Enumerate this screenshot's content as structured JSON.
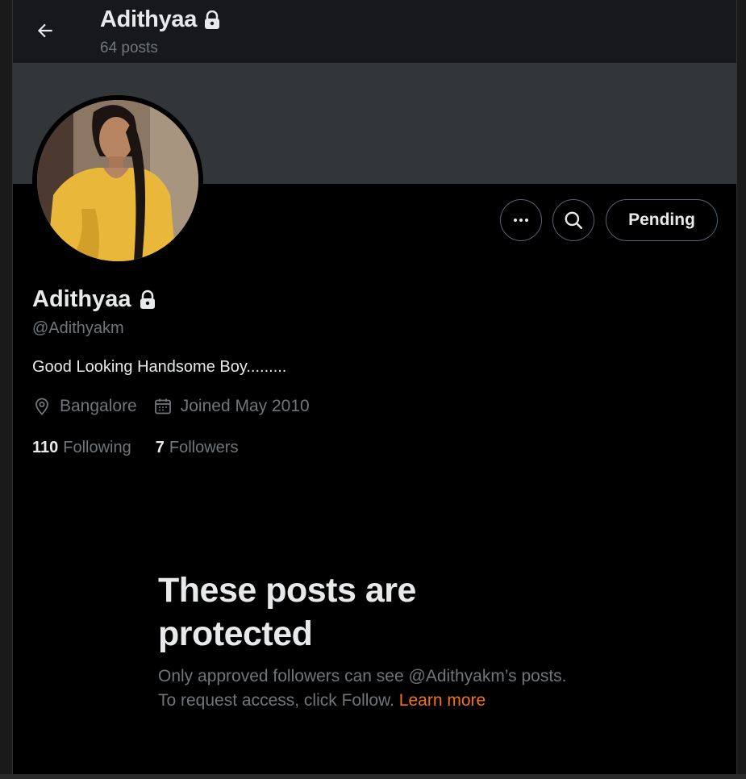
{
  "header": {
    "name": "Adithyaa",
    "posts_count": "64 posts"
  },
  "actions": {
    "more_icon": "ellipsis-icon",
    "search_icon": "search-icon",
    "pending_label": "Pending"
  },
  "profile": {
    "name": "Adithyaa",
    "handle": "@Adithyakm",
    "bio": "Good Looking Handsome Boy.........",
    "location": "Bangalore",
    "joined": "Joined May 2010",
    "following_count": "110",
    "following_label": "Following",
    "followers_count": "7",
    "followers_label": "Followers"
  },
  "protected": {
    "title": "These posts are protected",
    "text": "Only approved followers can see @Adithyakm’s posts. To request access, click Follow.",
    "learn_more": "Learn more"
  },
  "colors": {
    "background": "#000000",
    "banner": "#333639",
    "secondary_text": "#71767b",
    "link": "#f4711e"
  }
}
